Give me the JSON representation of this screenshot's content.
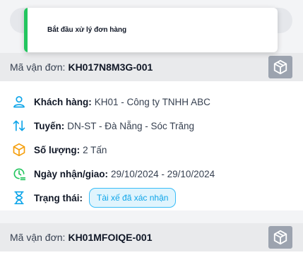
{
  "toast": {
    "message": "Bắt đầu xử lý đơn hàng"
  },
  "orders": [
    {
      "code_label": "Mã vận đơn:",
      "code": "KH017N8M3G-001",
      "customer_label": "Khách hàng:",
      "customer": "KH01 - Công ty TNHH ABC",
      "route_label": "Tuyến:",
      "route": "DN-ST - Đà Nẵng - Sóc Trăng",
      "quantity_label": "Số lượng:",
      "quantity": "2 Tấn",
      "dates_label": "Ngày nhận/giao:",
      "dates": "29/10/2024 - 29/10/2024",
      "status_label": "Trạng thái:",
      "status": "Tài xế đã xác nhận"
    },
    {
      "code_label": "Mã vận đơn:",
      "code": "KH01MFOIQE-001"
    }
  ],
  "colors": {
    "accent": "#0ea5e9",
    "toast_success": "#22c55e",
    "quantity_icon": "#f59e0b",
    "header_bg": "#e9eaec"
  },
  "icons": {
    "customer": "user-icon",
    "route": "swap-vertical-arrows-icon",
    "quantity": "package-box-icon",
    "dates": "clock-calendar-icon",
    "status": "hourglass-icon",
    "card_action": "cube-icon"
  }
}
